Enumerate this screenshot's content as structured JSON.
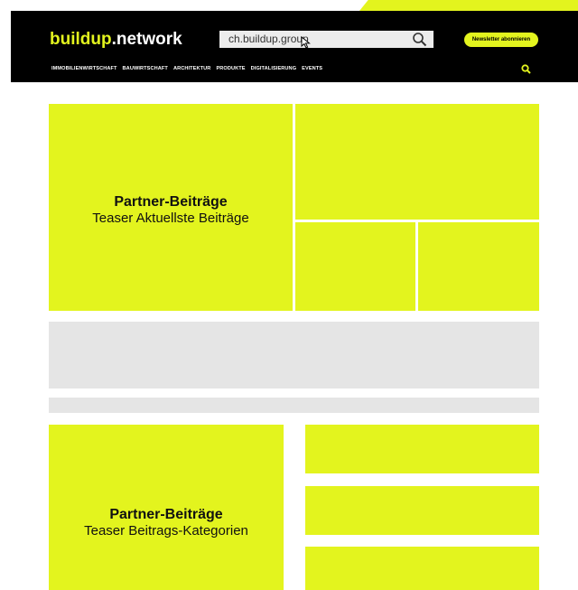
{
  "header": {
    "logo_brand": "buildup",
    "logo_rest": ".network",
    "search": {
      "value": "ch.buildup.group"
    },
    "newsletter_label": "Newsletter abonnieren",
    "nav": [
      "IMMOBILIENWIRTSCHAFT",
      "BAUWIRTSCHAFT",
      "ARCHITEKTUR",
      "PRODUKTE",
      "DIGITALISIERUNG",
      "EVENTS"
    ]
  },
  "colors": {
    "accent": "#e3f41e",
    "header_bg": "#000000",
    "placeholder_gray": "#e5e5e5"
  },
  "icons": {
    "search": "magnifier-icon",
    "cursor": "mouse-cursor-icon"
  },
  "section1": {
    "title": "Partner-Beiträge",
    "subtitle": "Teaser Aktuellste Beiträge"
  },
  "section2": {
    "title": "Partner-Beiträge",
    "subtitle": "Teaser Beitrags-Kategorien"
  }
}
